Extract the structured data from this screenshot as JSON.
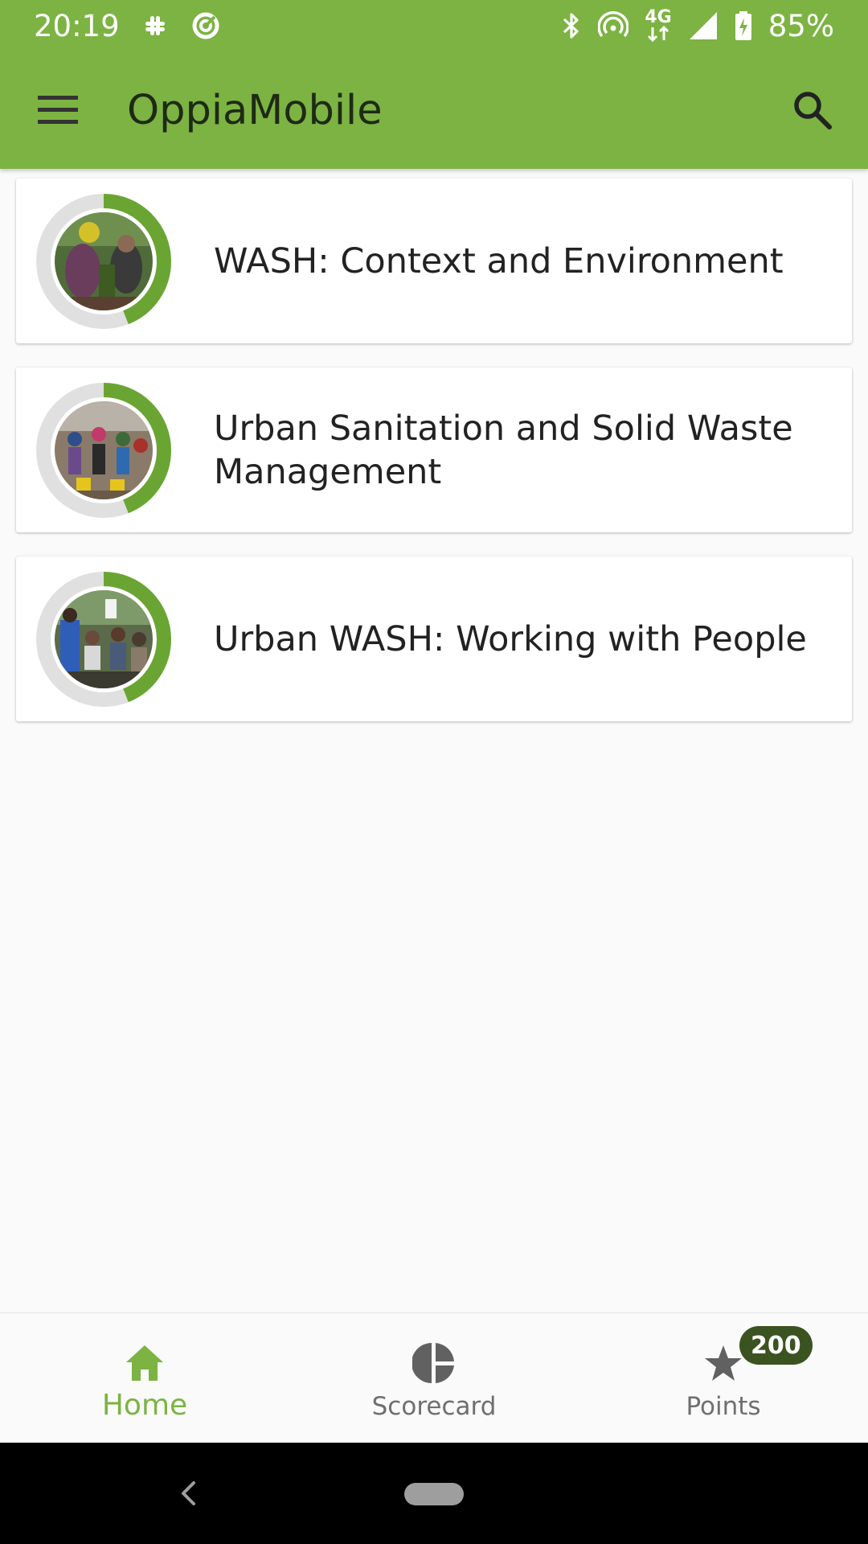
{
  "status_bar": {
    "time": "20:19",
    "network_type": "4G",
    "battery_percent": "85%",
    "icons": [
      "slack-icon",
      "data-saver-icon",
      "bluetooth-icon",
      "hotspot-icon",
      "signal-icon",
      "battery-charging-icon"
    ]
  },
  "toolbar": {
    "title": "OppiaMobile",
    "menu_icon": "hamburger-menu-icon",
    "search_icon": "search-icon",
    "background_color": "#7cb342"
  },
  "courses": [
    {
      "title": "WASH: Context and Environment",
      "progress": 0.44
    },
    {
      "title": "Urban Sanitation and Solid Waste Management",
      "progress": 0.44
    },
    {
      "title": "Urban WASH: Working with People",
      "progress": 0.44
    }
  ],
  "bottom_nav": {
    "items": [
      {
        "label": "Home",
        "icon": "home-icon",
        "active": true
      },
      {
        "label": "Scorecard",
        "icon": "pie-chart-icon",
        "active": false
      },
      {
        "label": "Points",
        "icon": "star-icon",
        "active": false,
        "badge": "200"
      }
    ],
    "active_color": "#7cb342"
  },
  "system_nav": {
    "icons": [
      "back-icon",
      "home-pill-icon"
    ]
  }
}
